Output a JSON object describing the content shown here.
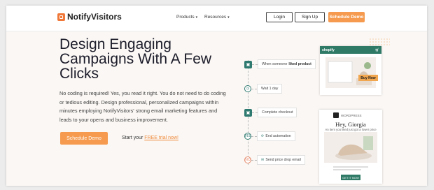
{
  "brand": {
    "name": "NotifyVisitors"
  },
  "nav": {
    "products": "Products",
    "resources": "Resources",
    "login": "Login",
    "signup": "Sign Up",
    "schedule": "Schedule Demo"
  },
  "hero": {
    "title": "Design Engaging Campaigns With A Few Clicks",
    "description": "No coding is required! Yes, you read it right. You do not need to do coding or tedious editing. Design professional, personalized campaigns within minutes employing NotifyVisitors' strong email marketing features and leads to your opens and business improvement.",
    "cta": "Schedule Demo",
    "trial_prefix": "Start your ",
    "trial_link": "FREE trial now!"
  },
  "flow": {
    "step1_prefix": "When someone",
    "step1_bold": "liked product",
    "step2": "Wait 1 day",
    "step3": "Complete checkout",
    "yes": "YES",
    "step4": "End automation",
    "no": "NO",
    "step5": "Send price drop email"
  },
  "shopify": {
    "brand": "shopify",
    "buy": "Buy Now"
  },
  "email": {
    "sender": "WORDPRESS",
    "greeting": "Hey, Giorgia",
    "subline": "An item you liked just got a lower price",
    "button": "GET IT NOW"
  },
  "colors": {
    "accent": "#f59a4e",
    "teal": "#2f7a70"
  }
}
